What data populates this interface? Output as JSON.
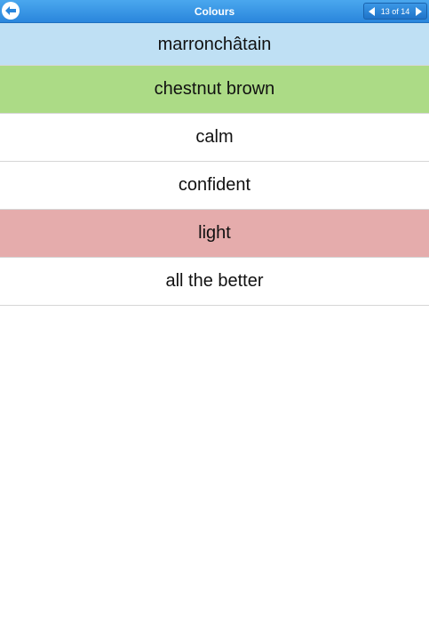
{
  "header": {
    "title": "Colours",
    "back_icon": "back-arrow-icon",
    "pager": {
      "text": "13 of 14",
      "prev_icon": "triangle-left-icon",
      "next_icon": "triangle-right-icon"
    }
  },
  "colors": {
    "header_bg": "#2a86dc",
    "question_bg": "#bfe0f4",
    "correct_bg": "#acdb86",
    "wrong_bg": "#e5acac",
    "neutral_bg": "#ffffff"
  },
  "quiz": {
    "question": "marronchâtain",
    "options": [
      "chestnut brown",
      "calm",
      "confident",
      "light",
      "all the better"
    ]
  }
}
